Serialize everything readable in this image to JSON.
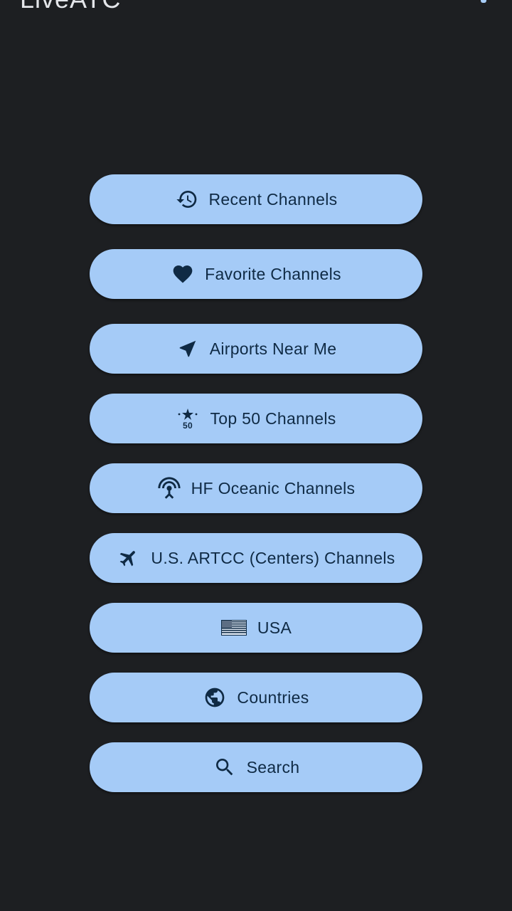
{
  "app": {
    "title": "LiveATC"
  },
  "colors": {
    "background": "#1d1f22",
    "button": "#a5cbf7",
    "button_text": "#0f2a44"
  },
  "menu": {
    "recent": {
      "label": "Recent Channels",
      "icon": "history-icon"
    },
    "favorites": {
      "label": "Favorite Channels",
      "icon": "heart-icon"
    },
    "airports": {
      "label": "Airports Near Me",
      "icon": "navigation-arrow-icon"
    },
    "top50": {
      "label": "Top 50 Channels",
      "icon": "top-50-star-icon",
      "icon_text": "50"
    },
    "hf": {
      "label": "HF Oceanic Channels",
      "icon": "radio-tower-icon"
    },
    "artcc": {
      "label": "U.S. ARTCC (Centers) Channels",
      "icon": "airplane-icon"
    },
    "usa": {
      "label": "USA",
      "icon": "us-flag-icon"
    },
    "countries": {
      "label": "Countries",
      "icon": "globe-icon"
    },
    "search": {
      "label": "Search",
      "icon": "search-icon"
    }
  }
}
